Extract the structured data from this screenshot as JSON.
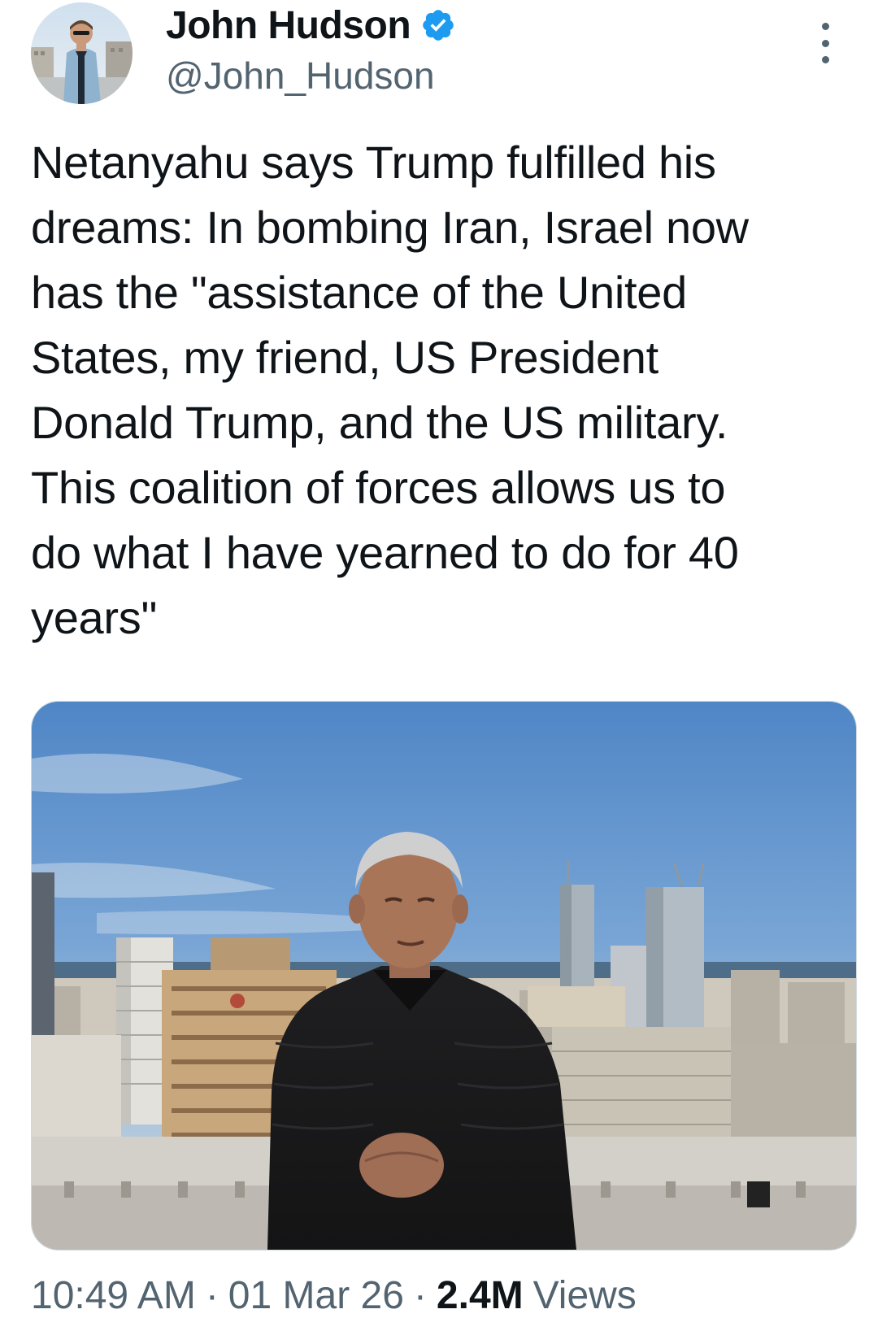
{
  "author": {
    "display_name": "John Hudson",
    "handle": "@John_Hudson",
    "verified": true,
    "verified_color": "#1d9bf0",
    "avatar_icon": "profile-photo"
  },
  "tweet": {
    "text": "Netanyahu says Trump fulfilled his\ndreams: In bombing Iran, Israel now\nhas the \"assistance of the United\nStates, my friend, US President\nDonald Trump, and the US military.\nThis coalition of forces allows us to\ndo what I have yearned to do for 40\nyears\""
  },
  "media": {
    "type": "photo",
    "icon": "photo-man-in-black-jacket-city-skyline"
  },
  "meta": {
    "time": "10:49 AM",
    "separator": "·",
    "date": "01 Mar 26",
    "views_count": "2.4M",
    "views_label": "Views"
  },
  "colors": {
    "text_primary": "#0f1419",
    "text_secondary": "#536471",
    "accent": "#1d9bf0"
  }
}
